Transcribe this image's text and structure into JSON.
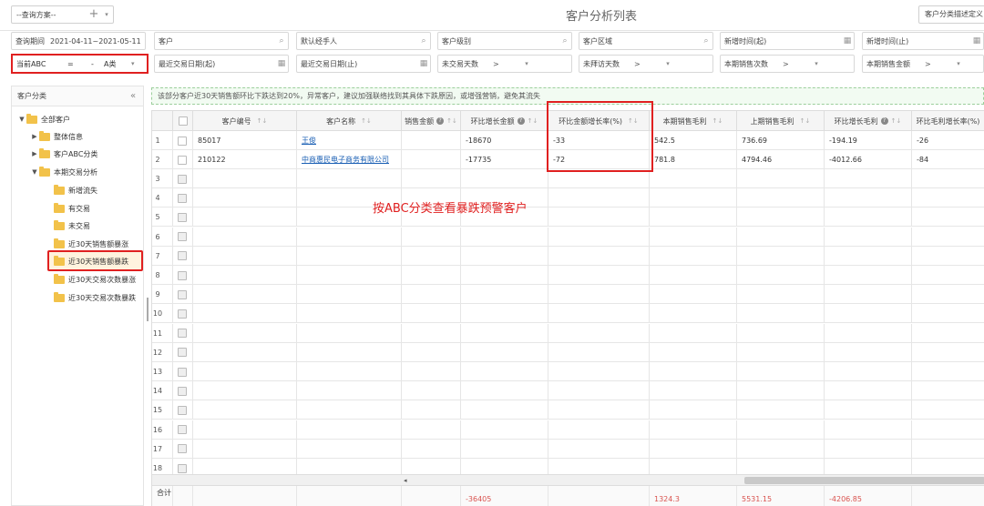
{
  "top": {
    "scheme_label": "--查询方案--",
    "plus": "+",
    "caret": "▾",
    "title": "客户分析列表",
    "right_button": "客户分类描述定义"
  },
  "filters": {
    "period_key": "查询期间",
    "period_value": "2021-04-11~2021-05-11",
    "row1": [
      "客户",
      "默认经手人",
      "客户级别",
      "客户区域",
      "新增时间(起)",
      "新增时间(止)"
    ],
    "row2": [
      {
        "label": "最近交易日期(起)",
        "op": ""
      },
      {
        "label": "最近交易日期(止)",
        "op": ""
      },
      {
        "label": "未交易天数",
        "op": ">"
      },
      {
        "label": "未拜访天数",
        "op": ">"
      },
      {
        "label": "本期销售次数",
        "op": ">"
      },
      {
        "label": "本期销售金额",
        "op": ">"
      }
    ],
    "abc_label": "当前ABC",
    "abc_op": "=",
    "abc_dash": "-",
    "abc_value": "A类"
  },
  "sidebar": {
    "title": "客户分类",
    "collapse": "«",
    "items": [
      {
        "label": "全部客户",
        "arrow": "▼"
      },
      {
        "label": "整体信息",
        "arrow": "▶"
      },
      {
        "label": "客户ABC分类",
        "arrow": "▶"
      },
      {
        "label": "本期交易分析",
        "arrow": "▼"
      },
      {
        "label": "新增流失",
        "arrow": ""
      },
      {
        "label": "有交易",
        "arrow": ""
      },
      {
        "label": "未交易",
        "arrow": ""
      },
      {
        "label": "近30天销售额暴涨",
        "arrow": ""
      },
      {
        "label": "近30天销售额暴跌",
        "arrow": ""
      },
      {
        "label": "近30天交易次数暴涨",
        "arrow": ""
      },
      {
        "label": "近30天交易次数暴跌",
        "arrow": ""
      }
    ]
  },
  "hint": "该部分客户近30天销售额环比下跌达到20%，异常客户，建议加强联络找到其具体下跌原因，或增强营销，避免其流失",
  "table": {
    "columns": [
      "客户编号",
      "客户名称",
      "销售金额",
      "环比增长金额",
      "环比金额增长率(%)",
      "本期销售毛利",
      "上期销售毛利",
      "环比增长毛利",
      "环比毛利增长率(%)"
    ],
    "rows": [
      {
        "no": "1",
        "code": "85017",
        "name": "王俊",
        "sales": "",
        "growth": "-18670",
        "rate": "-33",
        "cur_profit": "542.5",
        "prev_profit": "736.69",
        "profit_growth": "-194.19",
        "profit_rate": "-26"
      },
      {
        "no": "2",
        "code": "210122",
        "name": "中商惠民电子商务有限公司",
        "sales": "",
        "growth": "-17735",
        "rate": "-72",
        "cur_profit": "781.8",
        "prev_profit": "4794.46",
        "profit_growth": "-4012.66",
        "profit_rate": "-84"
      }
    ],
    "empty_rows": [
      "3",
      "4",
      "5",
      "6",
      "7",
      "8",
      "9",
      "10",
      "11",
      "12",
      "13",
      "14",
      "15",
      "16",
      "17",
      "18"
    ],
    "total_label": "合计",
    "totals": {
      "growth": "-36405",
      "cur_profit": "1324.3",
      "prev_profit": "5531.15",
      "profit_growth": "-4206.85"
    }
  },
  "annotation": "按ABC分类查看暴跌预警客户"
}
